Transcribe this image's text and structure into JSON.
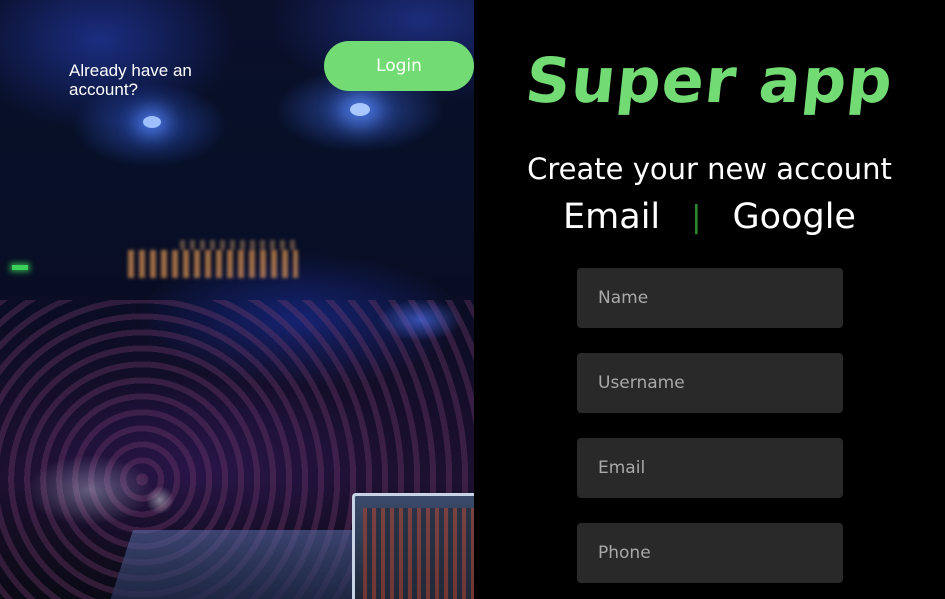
{
  "hero": {
    "tagline": "Already have an account?",
    "login_label": "Login"
  },
  "panel": {
    "logo": "Super app",
    "subtitle": "Create your new account",
    "auth_options": {
      "email": "Email",
      "separator": "|",
      "google": "Google"
    },
    "fields": {
      "name": {
        "placeholder": "Name",
        "value": ""
      },
      "username": {
        "placeholder": "Username",
        "value": ""
      },
      "email": {
        "placeholder": "Email",
        "value": ""
      },
      "phone": {
        "placeholder": "Phone",
        "value": ""
      }
    }
  },
  "colors": {
    "accent": "#72db73",
    "separator": "#2f8a30",
    "field_bg": "#292929",
    "panel_bg": "#000000"
  }
}
